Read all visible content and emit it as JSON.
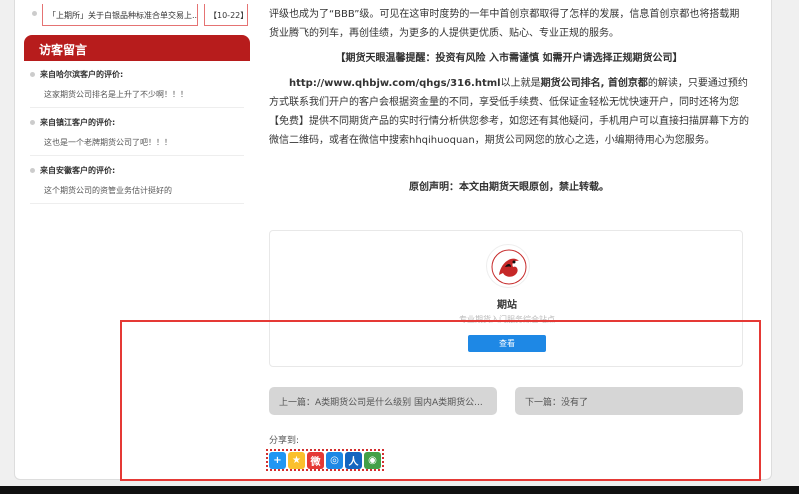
{
  "sidebar": {
    "top_item": {
      "title": "「上期所」关于白银品种标准合单交易上...",
      "date": "【10-22】"
    },
    "guestbook_title": "访客留言",
    "comments": [
      {
        "who": "来自哈尔滨客户的评价:",
        "text": "这家期货公司排名是上升了不少啊！！！"
      },
      {
        "who": "来自镇江客户的评价:",
        "text": "这也是一个老牌期货公司了吧！！！"
      },
      {
        "who": "来自安徽客户的评价:",
        "text": "这个期货公司的资管业务估计挺好的"
      }
    ]
  },
  "article": {
    "p1": "评级也成为了“BBB”级。可见在这审时度势的一年中首创京都取得了怎样的发展，信息首创京都也将搭载期货业腾飞的列车，再创佳绩，为更多的人提供更优质、贴心、专业正规的服务。",
    "tip": "【期货天眼温馨提醒：投资有风险 入市需谨慎 如需开户请选择正规期货公司】",
    "url": "http://www.qhbjw.com/qhgs/316.html",
    "p2_a": "以上就是",
    "p2_strong": "期货公司排名, 首创京都",
    "p2_b": "的解读，只要通过预约方式联系我们开户的客户会根据资金量的不同，享受低手续费、低保证金轻松无忧快速开户，同时还将为您【免费】提供不同期货产品的实时行情分析供您参考，如您还有其他疑问，手机用户可以直接扫描屏幕下方的微信二维码，或者在微信中搜索hhqihuoquan，期货公司网您的放心之选，小编期待用心为您服务。",
    "declare": "原创声明：本文由期货天眼原创，禁止转载。"
  },
  "author_card": {
    "name": "期站",
    "desc": "专业期货入门服务综合站点",
    "button": "查看"
  },
  "nav": {
    "prev": "上一篇：A类期货公司是什么级别 国内A类期货公...",
    "next": "下一篇：没有了"
  },
  "share": {
    "label": "分享到:",
    "icons": [
      {
        "name": "more-share-icon",
        "glyph": "+",
        "color": "#2196f3"
      },
      {
        "name": "qzone-icon",
        "glyph": "★",
        "color": "#fbc02d"
      },
      {
        "name": "weibo-icon",
        "glyph": "微",
        "color": "#e53935"
      },
      {
        "name": "tencent-weibo-icon",
        "glyph": "◎",
        "color": "#1e88e5"
      },
      {
        "name": "renren-icon",
        "glyph": "人",
        "color": "#1565c0"
      },
      {
        "name": "wechat-icon",
        "glyph": "◉",
        "color": "#43a047"
      }
    ]
  }
}
